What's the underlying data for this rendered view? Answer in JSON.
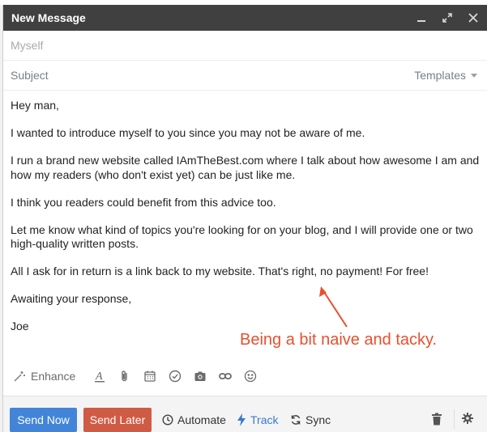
{
  "background_snippet": "...",
  "compose": {
    "title": "New Message",
    "to_placeholder": "Myself",
    "subject_placeholder": "Subject",
    "templates_label": "Templates"
  },
  "body": {
    "paragraphs": [
      "Hey man,",
      "I wanted to introduce myself to you since you may not be aware of me.",
      "I run a brand new website called IAmTheBest.com where I talk about how awesome I am and how my readers (who don't exist yet) can be just like me.",
      "I think you readers could benefit from this advice too.",
      "Let me know what kind of topics you're looking for on your blog, and I will provide one or two high-quality written posts.",
      "All I ask for in return is a link back to my website. That's right, no payment! For free!",
      "Awaiting your response,",
      "Joe"
    ]
  },
  "annotation": {
    "text": "Being a bit naive and tacky.",
    "color": "#e8502f"
  },
  "toolbar": {
    "enhance_label": "Enhance",
    "icons": [
      "wand-icon",
      "text-format-icon",
      "attach-icon",
      "calendar-icon",
      "checkmark-icon",
      "camera-icon",
      "link-icon",
      "emoji-icon"
    ]
  },
  "footer": {
    "send_now_label": "Send Now",
    "send_later_label": "Send Later",
    "automate_label": "Automate",
    "track_label": "Track",
    "sync_label": "Sync"
  },
  "colors": {
    "titlebar": "#404040",
    "send_now": "#4285d8",
    "send_later": "#d05b45",
    "track": "#3b78c9"
  }
}
